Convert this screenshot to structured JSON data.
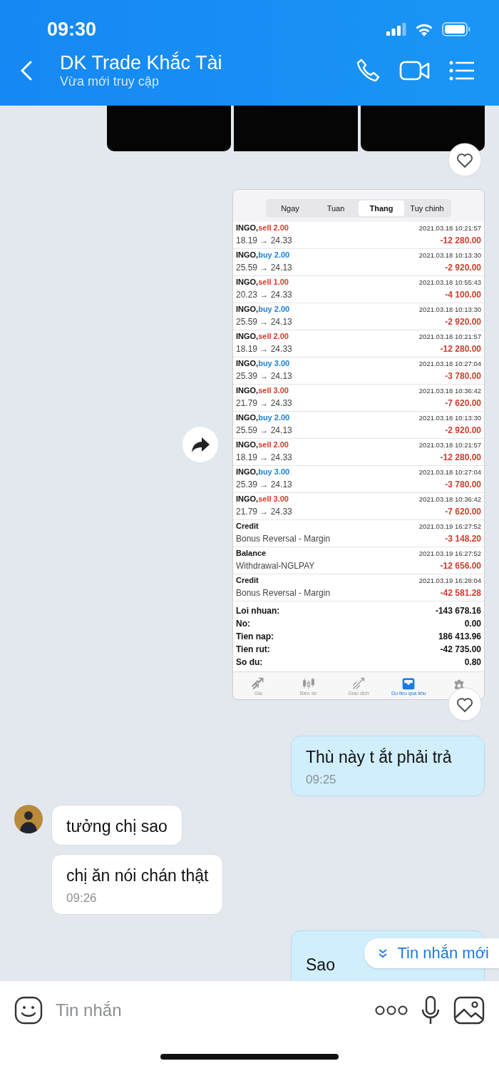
{
  "status_bar": {
    "time": "09:30"
  },
  "header": {
    "title": "DK Trade Khắc Tài",
    "subtitle": "Vừa mới truy cập"
  },
  "trade_screenshot": {
    "periods": [
      {
        "label": "Ngay",
        "selected": false
      },
      {
        "label": "Tuan",
        "selected": false
      },
      {
        "label": "Thang",
        "selected": true
      },
      {
        "label": "Tuy chinh",
        "selected": false
      }
    ],
    "rows": [
      {
        "kind": "sell",
        "title": "INGO,",
        "action": "sell 2.00",
        "time": "2021.03.18 10:21:57",
        "detail": "18.19 → 24.33",
        "amount": "-12 280.00"
      },
      {
        "kind": "buy",
        "title": "INGO,",
        "action": "buy 2.00",
        "time": "2021.03.18 10:13:30",
        "detail": "25.59 → 24.13",
        "amount": "-2 920.00"
      },
      {
        "kind": "sell",
        "title": "INGO,",
        "action": "sell 1.00",
        "time": "2021.03.18 10:55:43",
        "detail": "20.23 → 24.33",
        "amount": "-4 100.00"
      },
      {
        "kind": "buy",
        "title": "INGO,",
        "action": "buy 2.00",
        "time": "2021.03.18 10:13:30",
        "detail": "25.59 → 24.13",
        "amount": "-2 920.00"
      },
      {
        "kind": "sell",
        "title": "INGO,",
        "action": "sell 2.00",
        "time": "2021.03.18 10:21:57",
        "detail": "18.19 → 24.33",
        "amount": "-12 280.00"
      },
      {
        "kind": "buy",
        "title": "INGO,",
        "action": "buy 3.00",
        "time": "2021.03.18 10:27:04",
        "detail": "25.39 → 24.13",
        "amount": "-3 780.00"
      },
      {
        "kind": "sell",
        "title": "INGO,",
        "action": "sell 3.00",
        "time": "2021.03.18 10:36:42",
        "detail": "21.79 → 24.33",
        "amount": "-7 620.00"
      },
      {
        "kind": "buy",
        "title": "INGO,",
        "action": "buy 2.00",
        "time": "2021.03.18 10:13:30",
        "detail": "25.59 → 24.13",
        "amount": "-2 920.00"
      },
      {
        "kind": "sell",
        "title": "INGO,",
        "action": "sell 2.00",
        "time": "2021.03.18 10:21:57",
        "detail": "18.19 → 24.33",
        "amount": "-12 280.00"
      },
      {
        "kind": "buy",
        "title": "INGO,",
        "action": "buy 3.00",
        "time": "2021.03.18 10:27:04",
        "detail": "25.39 → 24.13",
        "amount": "-3 780.00"
      },
      {
        "kind": "sell",
        "title": "INGO,",
        "action": "sell 3.00",
        "time": "2021.03.18 10:36:42",
        "detail": "21.79 → 24.33",
        "amount": "-7 620.00"
      },
      {
        "kind": "plain",
        "title": "Credit",
        "time": "2021.03.19 16:27:52",
        "detail": "Bonus Reversal - Margin",
        "amount": "-3 148.20"
      },
      {
        "kind": "plain",
        "title": "Balance",
        "time": "2021.03.19 16:27:52",
        "detail": "Withdrawal-NGLPAY",
        "amount": "-12 656.00"
      },
      {
        "kind": "plain",
        "title": "Credit",
        "time": "2021.03.19 16:28:04",
        "detail": "Bonus Reversal - Margin",
        "amount": "-42 581.28"
      }
    ],
    "summary": [
      {
        "label": "Loi nhuan:",
        "value": "-143 678.16"
      },
      {
        "label": "No:",
        "value": "0.00"
      },
      {
        "label": "Tien nap:",
        "value": "186 413.96"
      },
      {
        "label": "Tien rut:",
        "value": "-42 735.00"
      },
      {
        "label": "So du:",
        "value": "0.80"
      }
    ],
    "tabs": [
      {
        "kind": "quotes",
        "label": "Gia",
        "selected": false
      },
      {
        "kind": "chart",
        "label": "Bieu do",
        "selected": false
      },
      {
        "kind": "trade",
        "label": "Giao dich",
        "selected": false
      },
      {
        "kind": "history",
        "label": "Du lieu qua khu",
        "selected": true
      },
      {
        "kind": "settings",
        "selected": false
      }
    ]
  },
  "messages": [
    {
      "kind": "out",
      "text": "Thù này t ắt phải trả",
      "time": "09:25"
    },
    {
      "kind": "in_avatar",
      "text": "tưởng chị sao"
    },
    {
      "kind": "in",
      "text": "chị ăn nói chán thật",
      "time": "09:26"
    },
    {
      "kind": "out",
      "text": "Sao"
    }
  ],
  "new_messages_badge": "Tin nhắn mới",
  "composer": {
    "placeholder": "Tin nhắn"
  }
}
